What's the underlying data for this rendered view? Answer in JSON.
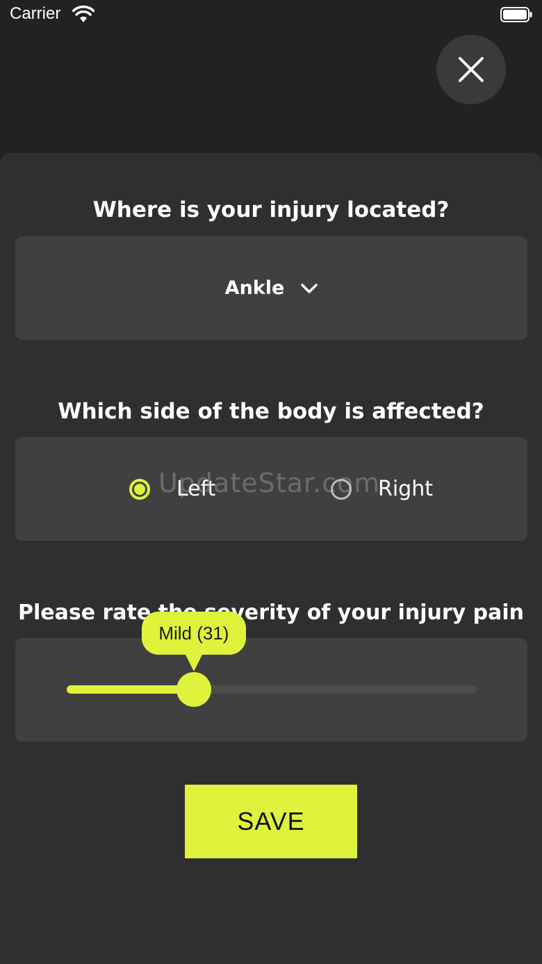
{
  "status_bar": {
    "carrier": "Carrier"
  },
  "close_icon": "close-icon",
  "questions": {
    "location": "Where is your injury located?",
    "side": "Which side of the body is affected?",
    "severity": "Please rate the severity of your injury pain"
  },
  "location_dropdown": {
    "selected": "Ankle",
    "icon": "chevron-down-icon"
  },
  "side_options": [
    {
      "label": "Left",
      "selected": true
    },
    {
      "label": "Right",
      "selected": false
    }
  ],
  "severity_slider": {
    "value": 31,
    "min": 0,
    "max": 100,
    "tooltip": "Mild (31)"
  },
  "save_button": {
    "label": "SAVE"
  },
  "watermark": "UpdateStar.com",
  "colors": {
    "accent": "#dff23c",
    "background": "#222222",
    "sheet": "#2f2f2f",
    "card": "#404040"
  }
}
